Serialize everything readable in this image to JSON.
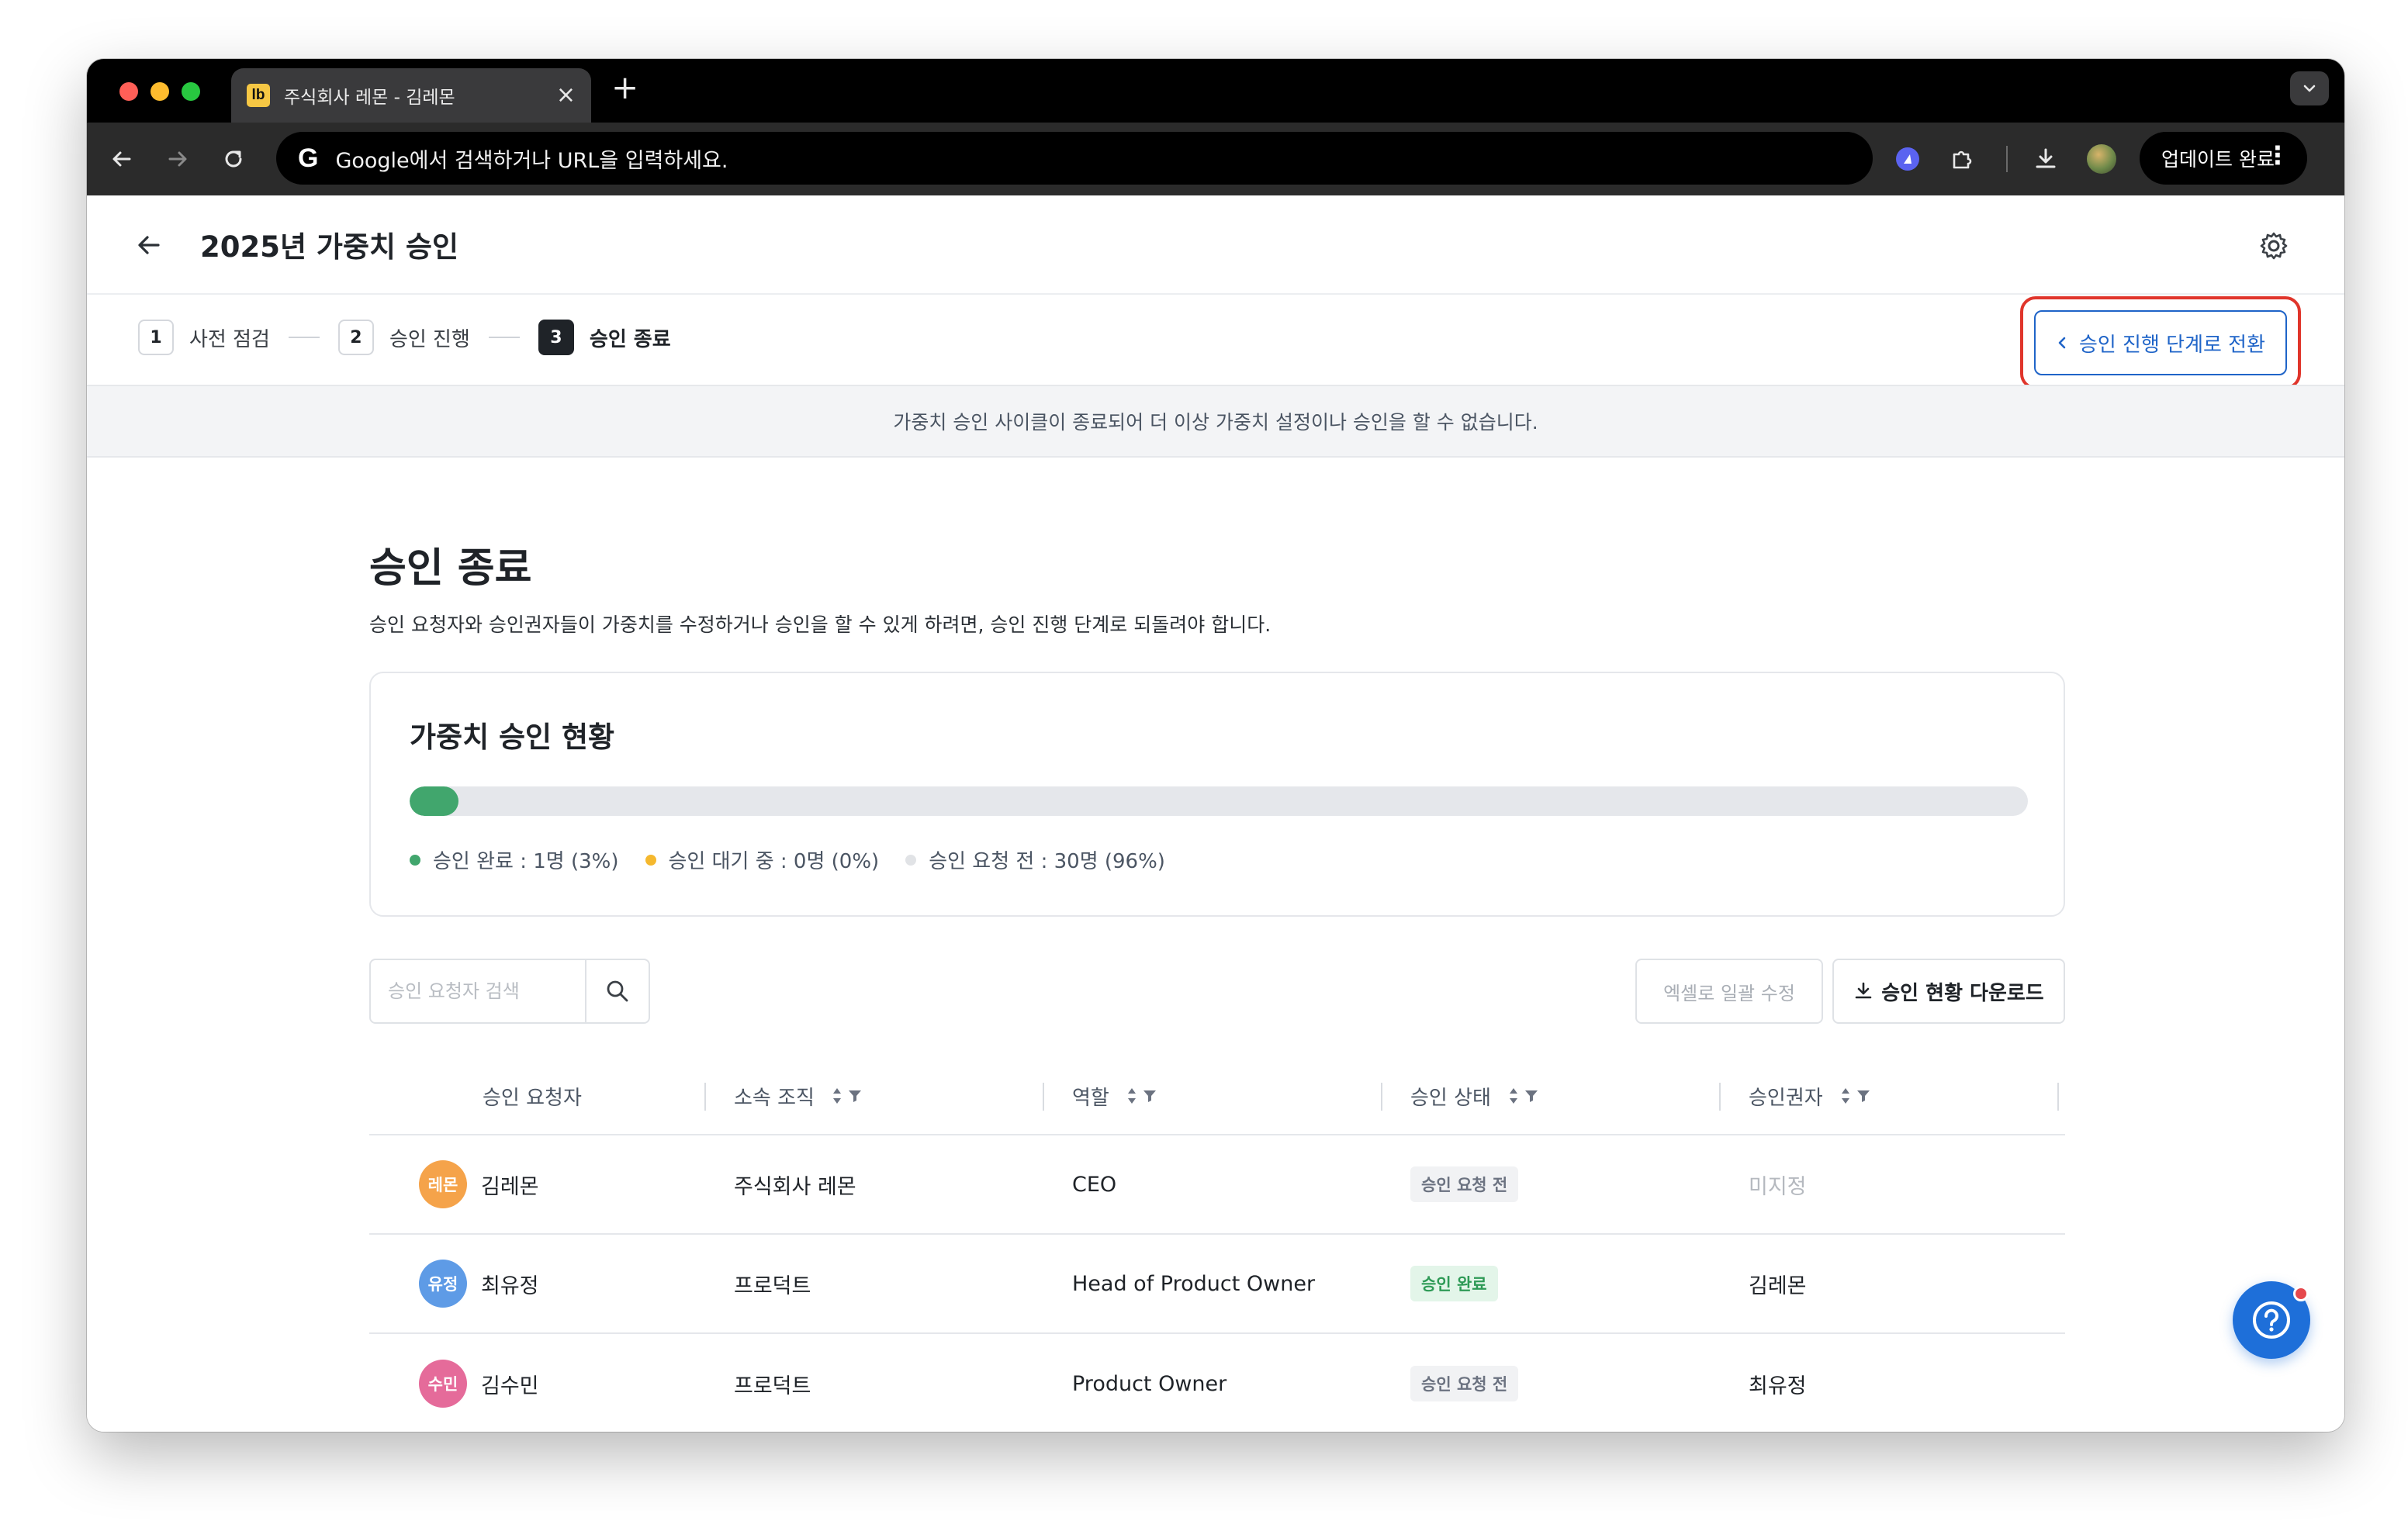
{
  "browser": {
    "tab_title": "주식회사 레몬 - 김레몬",
    "favicon_text": "lb",
    "new_tab_icon": "+",
    "close_icon": "×",
    "omnibox_placeholder": "Google에서 검색하거나 URL을 입력하세요.",
    "google_logo": "G",
    "update_button": "업데이트 완료"
  },
  "page": {
    "title": "2025년 가중치 승인",
    "steps": [
      {
        "number": "1",
        "label": "사전 점검",
        "active": false
      },
      {
        "number": "2",
        "label": "승인 진행",
        "active": false
      },
      {
        "number": "3",
        "label": "승인 종료",
        "active": true
      }
    ],
    "switch_button": "승인 진행 단계로 전환",
    "notice": "가중치 승인 사이클이 종료되어 더 이상 가중치 설정이나 승인을 할 수 없습니다.",
    "section_title": "승인 종료",
    "section_desc": "승인 요청자와 승인권자들이 가중치를 수정하거나 승인을 할 수 있게 하려면, 승인 진행 단계로 되돌려야 합니다."
  },
  "status_card": {
    "title": "가중치 승인 현황",
    "progress_fraction": 0.03,
    "legend": [
      {
        "label": "승인 완료 : 1명 (3%)",
        "color": "#41a66d"
      },
      {
        "label": "승인 대기 중 : 0명 (0%)",
        "color": "#f5b82e"
      },
      {
        "label": "승인 요청 전 : 30명 (96%)",
        "color": "#e1e3e6"
      }
    ]
  },
  "controls": {
    "search_placeholder": "승인 요청자 검색",
    "excel_button": "엑셀로 일괄 수정",
    "download_button": "승인 현황 다운로드"
  },
  "table": {
    "headers": [
      "승인 요청자",
      "소속 조직",
      "역할",
      "승인 상태",
      "승인권자"
    ],
    "rows": [
      {
        "avatar": "레몬",
        "avatar_color": "#f5a34a",
        "name": "김레몬",
        "org": "주식회사 레몬",
        "role": "CEO",
        "status": "승인 요청 전",
        "status_type": "pending",
        "approver": "미지정",
        "approver_muted": true
      },
      {
        "avatar": "유정",
        "avatar_color": "#5e9be6",
        "name": "최유정",
        "org": "프로덕트",
        "role": "Head of Product Owner",
        "status": "승인 완료",
        "status_type": "done",
        "approver": "김레몬",
        "approver_muted": false
      },
      {
        "avatar": "수민",
        "avatar_color": "#e56b9a",
        "name": "김수민",
        "org": "프로덕트",
        "role": "Product Owner",
        "status": "승인 요청 전",
        "status_type": "pending",
        "approver": "최유정",
        "approver_muted": false
      }
    ]
  },
  "help_button": "?"
}
